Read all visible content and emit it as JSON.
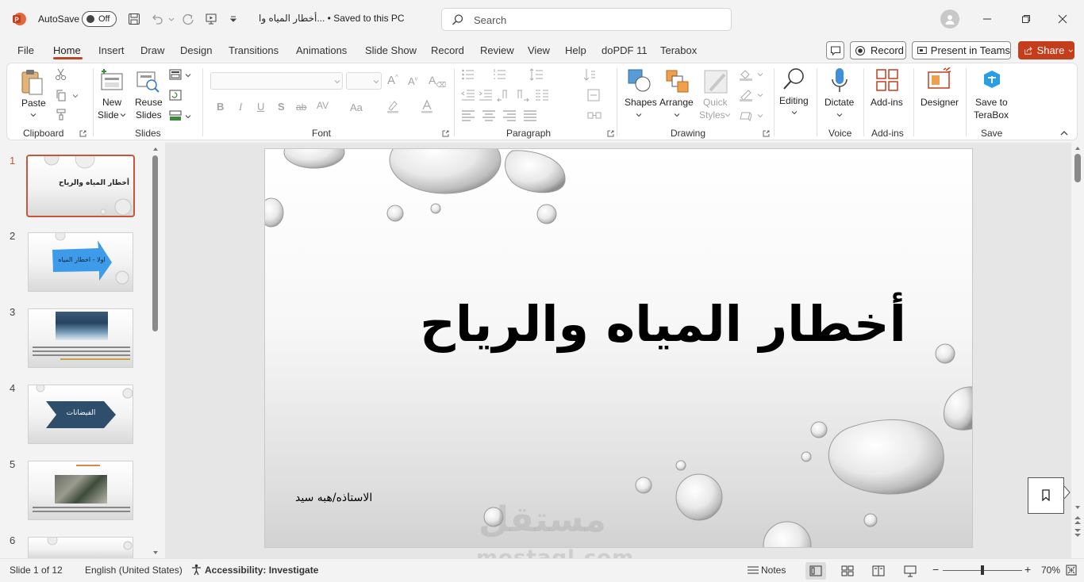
{
  "titlebar": {
    "app_icon": "powerpoint-icon",
    "autosave_label": "AutoSave",
    "autosave_state": "Off",
    "doc_title": "أخطار المياه وا...  •  Saved to this PC",
    "search_placeholder": "Search"
  },
  "tabs": [
    "File",
    "Home",
    "Insert",
    "Draw",
    "Design",
    "Transitions",
    "Animations",
    "Slide Show",
    "Record",
    "Review",
    "View",
    "Help",
    "doPDF 11",
    "Terabox"
  ],
  "active_tab": "Home",
  "right_buttons": {
    "record": "Record",
    "present": "Present in Teams",
    "share": "Share"
  },
  "ribbon": {
    "clipboard": {
      "paste": "Paste",
      "label": "Clipboard"
    },
    "slides": {
      "new_slide_1": "New",
      "new_slide_2": "Slide",
      "reuse_1": "Reuse",
      "reuse_2": "Slides",
      "label": "Slides"
    },
    "font": {
      "label": "Font"
    },
    "paragraph": {
      "label": "Paragraph"
    },
    "drawing": {
      "shapes": "Shapes",
      "arrange": "Arrange",
      "quick_1": "Quick",
      "quick_2": "Styles",
      "label": "Drawing"
    },
    "editing": {
      "label": "Editing"
    },
    "voice": {
      "dictate": "Dictate",
      "label": "Voice"
    },
    "addins": {
      "addins": "Add-ins",
      "label": "Add-ins"
    },
    "designer": {
      "label": "Designer"
    },
    "save": {
      "terabox_1": "Save to",
      "terabox_2": "TeraBox",
      "label": "Save"
    }
  },
  "thumbnails": [
    {
      "num": "1",
      "text": "أخطار المياه والرياح"
    },
    {
      "num": "2",
      "text": "اولا - اخطار المياه"
    },
    {
      "num": "3",
      "text": ""
    },
    {
      "num": "4",
      "text": "الفيضانات"
    },
    {
      "num": "5",
      "text": ""
    },
    {
      "num": "6",
      "text": ""
    }
  ],
  "slide": {
    "title": "أخطار المياه والرياح",
    "subtitle": "الاستاذه/هبه سيد"
  },
  "status": {
    "slide_of": "Slide 1 of 12",
    "language": "English (United States)",
    "accessibility": "Accessibility: Investigate",
    "notes": "Notes",
    "zoom": "70%",
    "zoom_fraction": 0.5
  },
  "watermark": {
    "arabic": "مستقل",
    "latin": "mostaql.com"
  },
  "colors": {
    "accent": "#b7472a",
    "share": "#c43e1c",
    "selection": "#c8553d"
  }
}
